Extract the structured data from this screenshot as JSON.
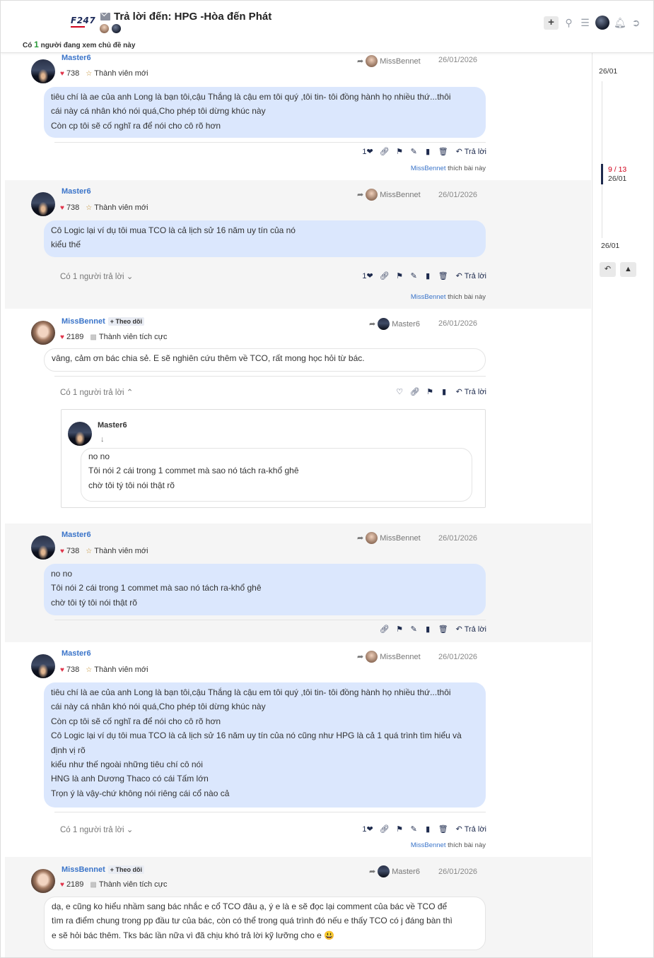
{
  "header": {
    "logo": "F247",
    "title": "Trả lời đến: HPG -Hòa đến Phát",
    "viewing_prefix": "Có",
    "viewing_count": "1",
    "viewing_suffix": "người đang xem chủ đề này",
    "add_button": "+"
  },
  "timeline": {
    "top_date": "26/01",
    "current": "9 / 13",
    "current_date": "26/01",
    "bottom_date": "26/01"
  },
  "posts": [
    {
      "user": "Master6",
      "likes_count": "738",
      "rank": "Thành viên mới",
      "reply_to": "MissBennet",
      "date": "26/01/2026",
      "lines": [
        "tiêu chí là ae của anh Long là bạn tôi,cậu Thắng là cậu em tôi quý ,tôi tin- tôi đồng hành họ nhiều thứ...thôi",
        "cái này cá nhân khó nói quá,Cho phép tôi dừng khúc này",
        "Còn cp tôi sẽ cố nghĩ ra để nói cho cô rõ hơn"
      ],
      "like_count": "1",
      "reply_label": "Trả lời",
      "liked_by": "MissBennet",
      "liked_suffix": "thích bài này"
    },
    {
      "user": "Master6",
      "likes_count": "738",
      "rank": "Thành viên mới",
      "reply_to": "MissBennet",
      "date": "26/01/2026",
      "lines": [
        "Cô Logic lại ví dụ tôi mua TCO là cả lịch sử 16 năm uy tín của nó",
        "kiểu thế"
      ],
      "replies": "Có 1 người trả lời",
      "like_count": "1",
      "reply_label": "Trả lời",
      "liked_by": "MissBennet",
      "liked_suffix": "thích bài này"
    },
    {
      "user": "MissBennet",
      "follow": "Theo dõi",
      "likes_count": "2189",
      "rank": "Thành viên tích cực",
      "reply_to": "Master6",
      "date": "26/01/2026",
      "lines": [
        "vâng, cảm ơn bác chia sẻ. E sẽ nghiên cứu thêm về TCO, rất mong học hỏi từ bác."
      ],
      "replies": "Có 1 người trả lời",
      "reply_label": "Trả lời",
      "quote": {
        "user": "Master6",
        "lines": [
          "no no",
          "Tôi nói 2 cái trong 1 commet mà sao nó tách ra-khổ ghê",
          "chờ tôi tý tôi nói thật rõ"
        ]
      }
    },
    {
      "user": "Master6",
      "likes_count": "738",
      "rank": "Thành viên mới",
      "reply_to": "MissBennet",
      "date": "26/01/2026",
      "lines": [
        "no no",
        "Tôi nói 2 cái trong 1 commet mà sao nó tách ra-khổ ghê",
        "chờ tôi tý tôi nói thật rõ"
      ],
      "reply_label": "Trả lời"
    },
    {
      "user": "Master6",
      "likes_count": "738",
      "rank": "Thành viên mới",
      "reply_to": "MissBennet",
      "date": "26/01/2026",
      "lines": [
        "tiêu chí là ae của anh Long là bạn tôi,cậu Thắng là cậu em tôi quý ,tôi tin- tôi đồng hành họ nhiều thứ...thôi",
        "cái này cá nhân khó nói quá,Cho phép tôi dừng khúc này",
        "Còn cp tôi sẽ cố nghĩ ra để nói cho cô rõ hơn",
        "Cô Logic lại ví dụ tôi mua TCO là cả lịch sử 16 năm uy tín của nó cũng như HPG là cả 1 quá trình tìm hiểu và",
        "định vị rõ",
        "kiểu như thế ngoài những tiêu chí cô nói",
        "HNG là anh Dương Thaco có cái Tấm lớn",
        "Trọn ý là vậy-chứ không nói riêng cái cổ nào cả"
      ],
      "replies": "Có 1 người trả lời",
      "like_count": "1",
      "reply_label": "Trả lời",
      "liked_by": "MissBennet",
      "liked_suffix": "thích bài này"
    },
    {
      "user": "MissBennet",
      "follow": "Theo dõi",
      "likes_count": "2189",
      "rank": "Thành viên tích cực",
      "reply_to": "Master6",
      "date": "26/01/2026",
      "lines": [
        "dạ, e cũng ko hiểu nhầm sang bác nhắc e cổ TCO đâu ạ, ý e là e sẽ đọc lại comment của bác về TCO để",
        "tìm ra điểm chung trong pp đầu tư của bác, còn có thể trong quá trình đó nếu e thấy TCO có j đáng bàn thì",
        "e sẽ hỏi bác thêm. Tks bác lần nữa vì đã chịu khó trả lời kỹ lưỡng cho e 😃"
      ]
    }
  ]
}
